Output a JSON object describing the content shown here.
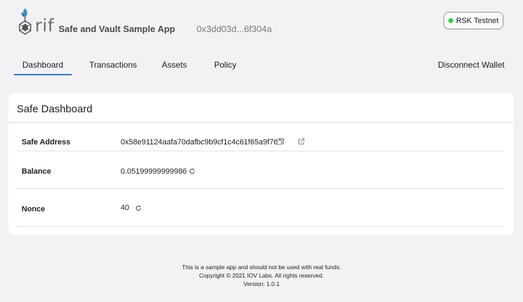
{
  "header": {
    "logo_word": "rif",
    "app_title": "Safe and Vault Sample App",
    "address_short": "0x3dd03d...6f304a",
    "network": {
      "label": "RSK Testnet",
      "status_color": "#2bd22b"
    }
  },
  "nav": {
    "tabs": [
      {
        "label": "Dashboard",
        "active": true
      },
      {
        "label": "Transactions",
        "active": false
      },
      {
        "label": "Assets",
        "active": false
      },
      {
        "label": "Policy",
        "active": false
      }
    ],
    "disconnect_label": "Disconnect Wallet",
    "accent_color": "#2f7ecf"
  },
  "card": {
    "title": "Safe Dashboard",
    "rows": [
      {
        "label": "Safe Address",
        "value": "0x58e91124aafa70dafbc9b9cf1c4c61f65a9f766f",
        "icons": [
          "copy-icon",
          "external-link-icon"
        ]
      },
      {
        "label": "Balance",
        "value": "0.05199999999986",
        "icons": [
          "refresh-icon"
        ]
      },
      {
        "label": "Nonce",
        "value": "40",
        "icons": [
          "refresh-icon"
        ]
      }
    ]
  },
  "footer": {
    "line1": "This is a sample app and should not be used with real funds.",
    "line2": "Copyright © 2021 IOV Labs. All rights reserved.",
    "line3": "Version: 1.0.1"
  }
}
